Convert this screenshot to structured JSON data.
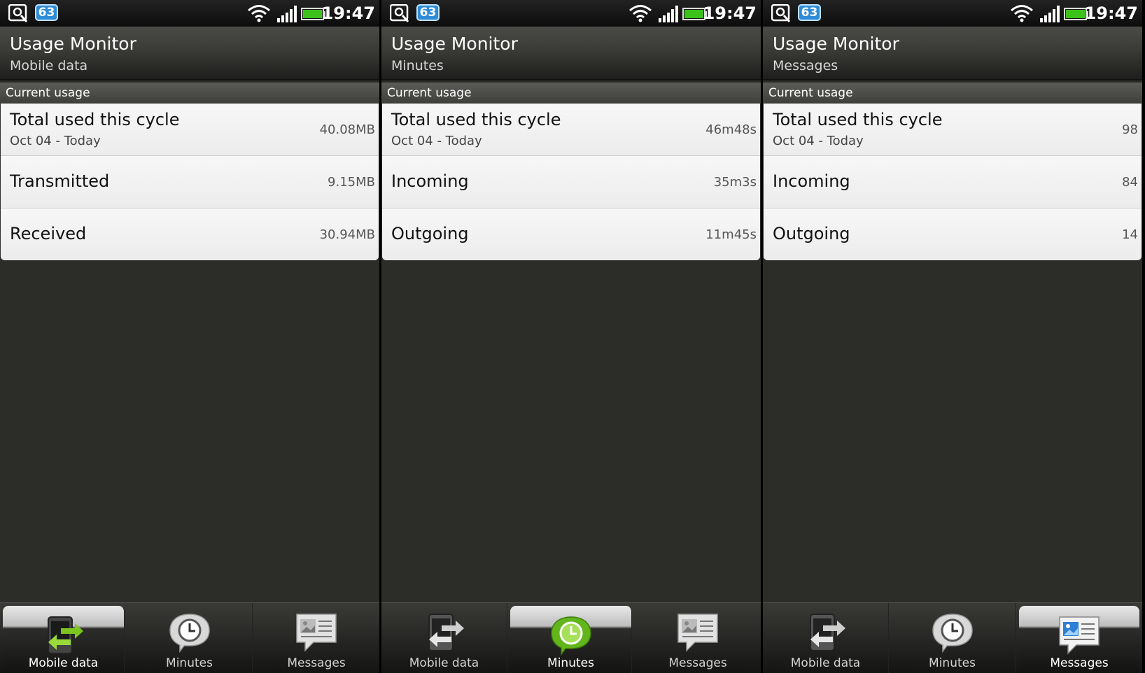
{
  "status": {
    "badge": "63",
    "time": "19:47"
  },
  "screens": [
    {
      "app_title": "Usage Monitor",
      "subtitle": "Mobile data",
      "section": "Current usage",
      "total": {
        "label": "Total used this cycle",
        "sub": "Oct 04 - Today",
        "value": "40.08MB"
      },
      "row2": {
        "label": "Transmitted",
        "value": "9.15MB"
      },
      "row3": {
        "label": "Received",
        "value": "30.94MB"
      },
      "active_tab": 0
    },
    {
      "app_title": "Usage Monitor",
      "subtitle": "Minutes",
      "section": "Current usage",
      "total": {
        "label": "Total used this cycle",
        "sub": "Oct 04 - Today",
        "value": "46m48s"
      },
      "row2": {
        "label": "Incoming",
        "value": "35m3s"
      },
      "row3": {
        "label": "Outgoing",
        "value": "11m45s"
      },
      "active_tab": 1
    },
    {
      "app_title": "Usage Monitor",
      "subtitle": "Messages",
      "section": "Current usage",
      "total": {
        "label": "Total used this cycle",
        "sub": "Oct 04 - Today",
        "value": "98"
      },
      "row2": {
        "label": "Incoming",
        "value": "84"
      },
      "row3": {
        "label": "Outgoing",
        "value": "14"
      },
      "active_tab": 2
    }
  ],
  "tabs": [
    {
      "label": "Mobile data",
      "icon": "phone-transfer-icon"
    },
    {
      "label": "Minutes",
      "icon": "clock-icon"
    },
    {
      "label": "Messages",
      "icon": "message-image-icon"
    }
  ],
  "colors": {
    "accent": "#7cc520",
    "badge": "#2e8bd6",
    "background": "#2c2c29"
  }
}
